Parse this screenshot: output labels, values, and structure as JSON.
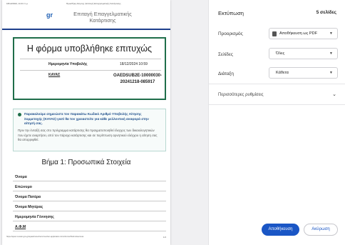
{
  "preview": {
    "header_date": "18/12/2024, 11:01 π.μ.",
    "header_title": "Προσθήκη Αίτησης | Επιταγή Επαγγελματικής Κατάρτισης",
    "logo": "gr",
    "org_name": "Επιταγή Επαγγελματικής Κατάρτισης",
    "success_title": "Η φόρμα υποβλήθηκε επιτυχώς",
    "submission_date_label": "Ημερομηνία Υποβολής",
    "submission_date_value": "18/12/2024 10:59",
    "kayas_label": "ΚΑΥΑΣ",
    "kayas_value": "OAEDSUB2E-10000030-20241218-085917",
    "info_bold": "Παρακαλούμε σημειώστε τον παρακάτω Κωδικό Αριθμό Υποβολής Αίτησης Συμμετοχής (ΚΑΥΑΣ) γιατί θα τον χρειαστείτε για κάθε μελλοντική αναφορά στην αίτησή σας.",
    "info_text": "Πριν την ένταξή σας στο πρόγραμμα κατάρτισης θα πραγματοποιηθεί έλεγχος των δικαιολογητικών που έχετε αναρτήσει, από τον πάροχο κατάρτισης και σε περίπτωση αρνητικού ελέγχου η αίτηση σας θα απορριφθεί.",
    "step_title": "Βήμα 1: Προσωπικά Στοιχεία",
    "fields": [
      "Όνομα",
      "Επώνυμο",
      "Όνομα Πατέρα",
      "Όνομα Μητέρας",
      "Ημερομηνία Γέννησης",
      "Α.Φ.Μ"
    ],
    "footer_url": "https://epac.reuster.gov.gr/epaeb/vouchers/voucher-application-form/Form2/Submitsuccess",
    "footer_page": "1/4"
  },
  "panel": {
    "title": "Εκτύπωση",
    "pages_count": "5 σελίδες",
    "destination_label": "Προορισμός",
    "destination_value": "Αποθήκευση ως PDF",
    "pages_label": "Σελίδες",
    "pages_value": "Όλες",
    "layout_label": "Διάταξη",
    "layout_value": "Κάθετα",
    "more_settings": "Περισσότερες ρυθμίσεις",
    "save_button": "Αποθήκευση",
    "cancel_button": "Ακύρωση"
  },
  "icons": {
    "dropdown": "chevron-down-icon",
    "pdf": "pdf-file-icon",
    "info": "info-icon"
  }
}
